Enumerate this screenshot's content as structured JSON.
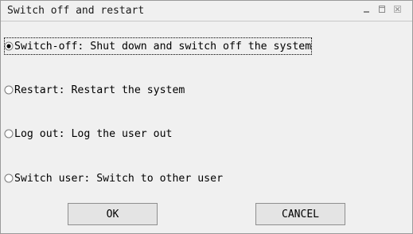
{
  "window": {
    "title": "Switch off and restart",
    "controls": [
      "minimize-icon",
      "maximize-icon",
      "close-icon"
    ]
  },
  "options": [
    {
      "label": "Switch-off: Shut down and switch off the system",
      "selected": true
    },
    {
      "label": "Restart: Restart the system",
      "selected": false
    },
    {
      "label": "Log out: Log the user out",
      "selected": false
    },
    {
      "label": "Switch user: Switch to other user",
      "selected": false
    }
  ],
  "buttons": {
    "ok": "OK",
    "cancel": "CANCEL"
  }
}
